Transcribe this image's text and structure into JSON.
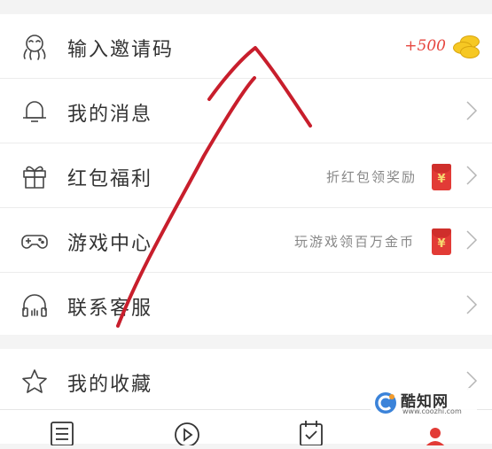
{
  "menu_section_1": {
    "items": [
      {
        "label": "输入邀请码",
        "icon": "invite-code-icon",
        "bonus": "+500"
      },
      {
        "label": "我的消息",
        "icon": "bell-icon"
      },
      {
        "label": "红包福利",
        "icon": "gift-icon",
        "hint": "折红包领奖励"
      },
      {
        "label": "游戏中心",
        "icon": "gamepad-icon",
        "hint": "玩游戏领百万金币"
      },
      {
        "label": "联系客服",
        "icon": "headset-icon"
      }
    ]
  },
  "menu_section_2": {
    "items": [
      {
        "label": "我的收藏",
        "icon": "star-icon"
      }
    ]
  },
  "red_packet_symbol": "¥",
  "watermark": {
    "name": "酷知网",
    "url": "www.coozhi.com"
  },
  "colors": {
    "accent_red": "#e6463f",
    "annotation_red": "#c81e2c",
    "coin_gold": "#f6c823"
  }
}
